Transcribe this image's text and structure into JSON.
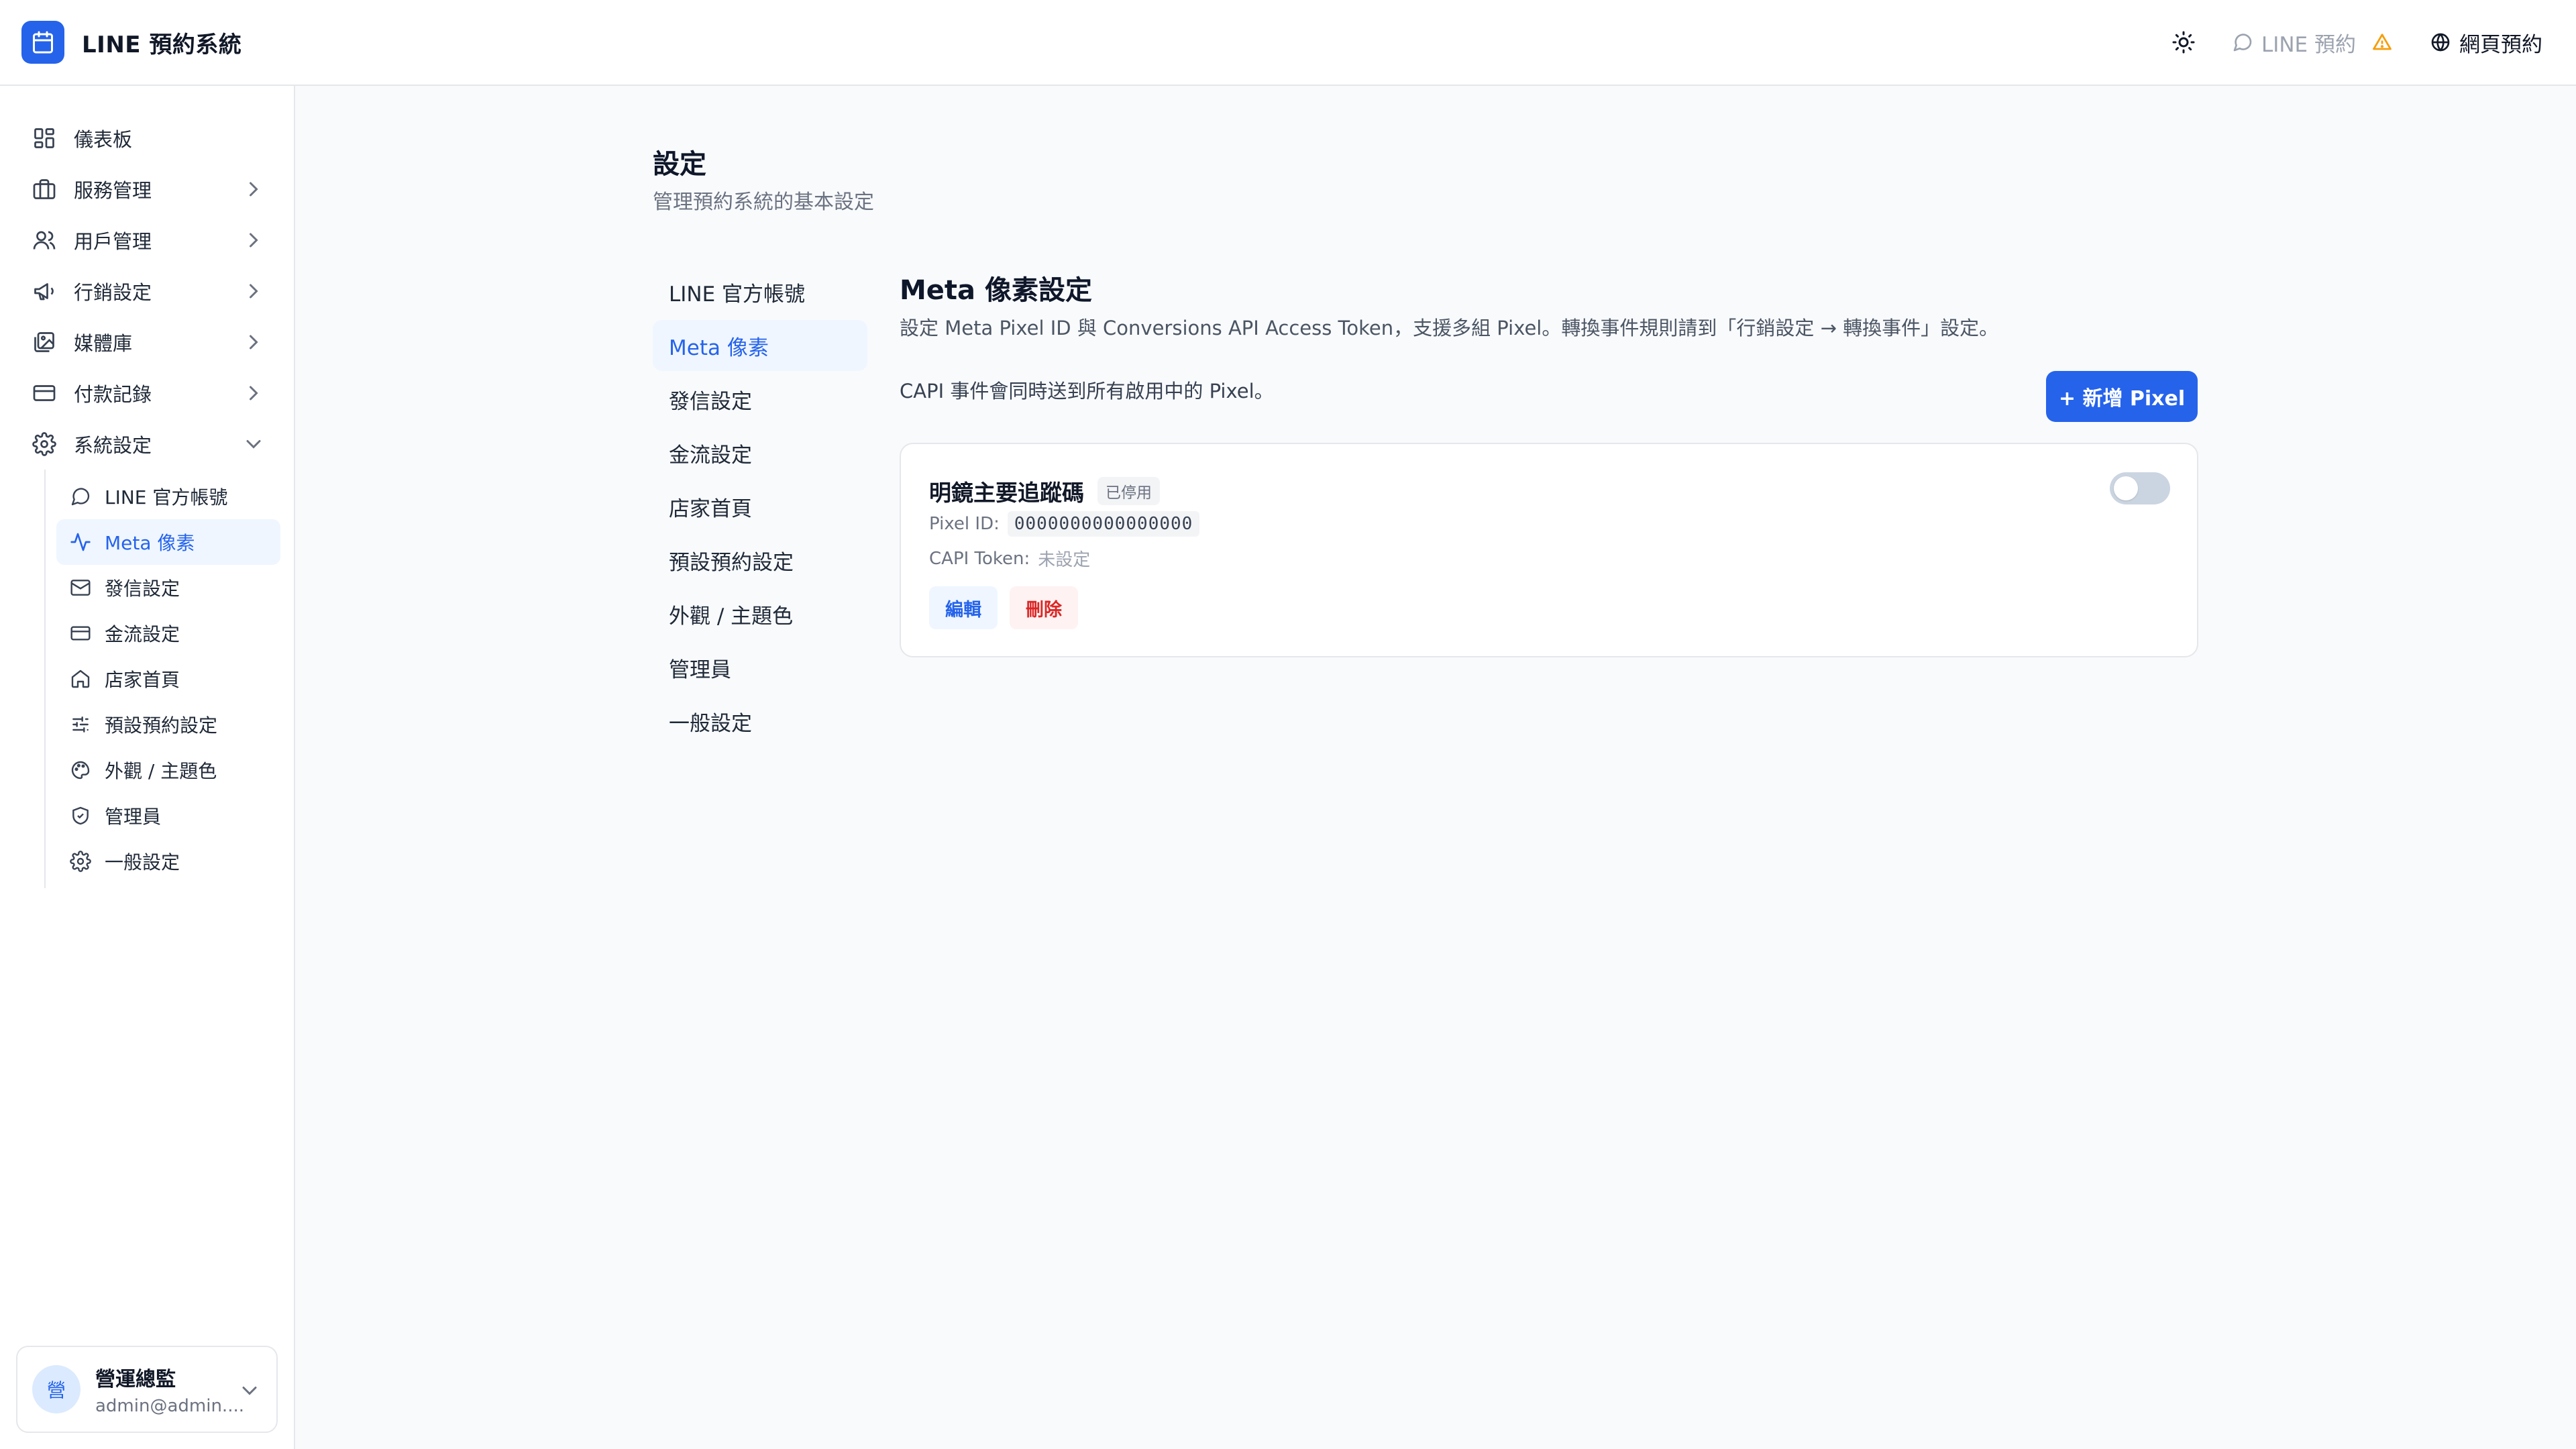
{
  "app": {
    "title": "LINE 預約系統",
    "accent_color": "#2563eb"
  },
  "header": {
    "theme_icon": "sun-icon",
    "line_link": {
      "icon": "message-circle-icon",
      "label": "LINE 預約",
      "badge_icon": "warning-triangle-icon",
      "badge_color": "#f59e0b"
    },
    "web_link": {
      "icon": "globe-icon",
      "label": "網頁預約"
    }
  },
  "sidebar": {
    "items": [
      {
        "label": "儀表板",
        "icon": "dashboard-icon"
      },
      {
        "label": "服務管理",
        "icon": "briefcase-icon"
      },
      {
        "label": "用戶管理",
        "icon": "users-icon"
      },
      {
        "label": "行銷設定",
        "icon": "megaphone-icon"
      },
      {
        "label": "媒體庫",
        "icon": "images-icon"
      },
      {
        "label": "付款記錄",
        "icon": "credit-card-icon"
      },
      {
        "label": "系統設定",
        "icon": "gear-icon"
      }
    ],
    "sub_items": [
      {
        "label": "LINE 官方帳號",
        "icon": "message-circle-icon"
      },
      {
        "label": "Meta 像素",
        "icon": "activity-icon"
      },
      {
        "label": "發信設定",
        "icon": "mail-icon"
      },
      {
        "label": "金流設定",
        "icon": "credit-card-icon"
      },
      {
        "label": "店家首頁",
        "icon": "home-icon"
      },
      {
        "label": "預設預約設定",
        "icon": "sliders-icon"
      },
      {
        "label": "外觀 / 主題色",
        "icon": "palette-icon"
      },
      {
        "label": "管理員",
        "icon": "shield-check-icon"
      },
      {
        "label": "一般設定",
        "icon": "gear-icon"
      }
    ],
    "active_sub": "Meta 像素"
  },
  "user": {
    "avatar_text": "營",
    "name": "營運總監",
    "email": "admin@admin...."
  },
  "page": {
    "title": "設定",
    "subtitle": "管理預約系統的基本設定"
  },
  "settings_nav": {
    "items": [
      "LINE 官方帳號",
      "Meta 像素",
      "發信設定",
      "金流設定",
      "店家首頁",
      "預設預約設定",
      "外觀 / 主題色",
      "管理員",
      "一般設定"
    ],
    "active": "Meta 像素"
  },
  "section": {
    "title": "Meta 像素設定",
    "description": "設定 Meta Pixel ID 與 Conversions API Access Token，支援多組 Pixel。轉換事件規則請到「行銷設定 → 轉換事件」設定。",
    "capi_note": "CAPI 事件會同時送到所有啟用中的 Pixel。",
    "add_button": "+ 新增 Pixel"
  },
  "pixels": [
    {
      "name": "明鏡主要追蹤碼",
      "status": "已停用",
      "enabled": false,
      "pixel_id_label": "Pixel ID:",
      "pixel_id": "0000000000000000",
      "token_label": "CAPI Token:",
      "token_value": "未設定",
      "edit_label": "編輯",
      "delete_label": "刪除"
    }
  ]
}
